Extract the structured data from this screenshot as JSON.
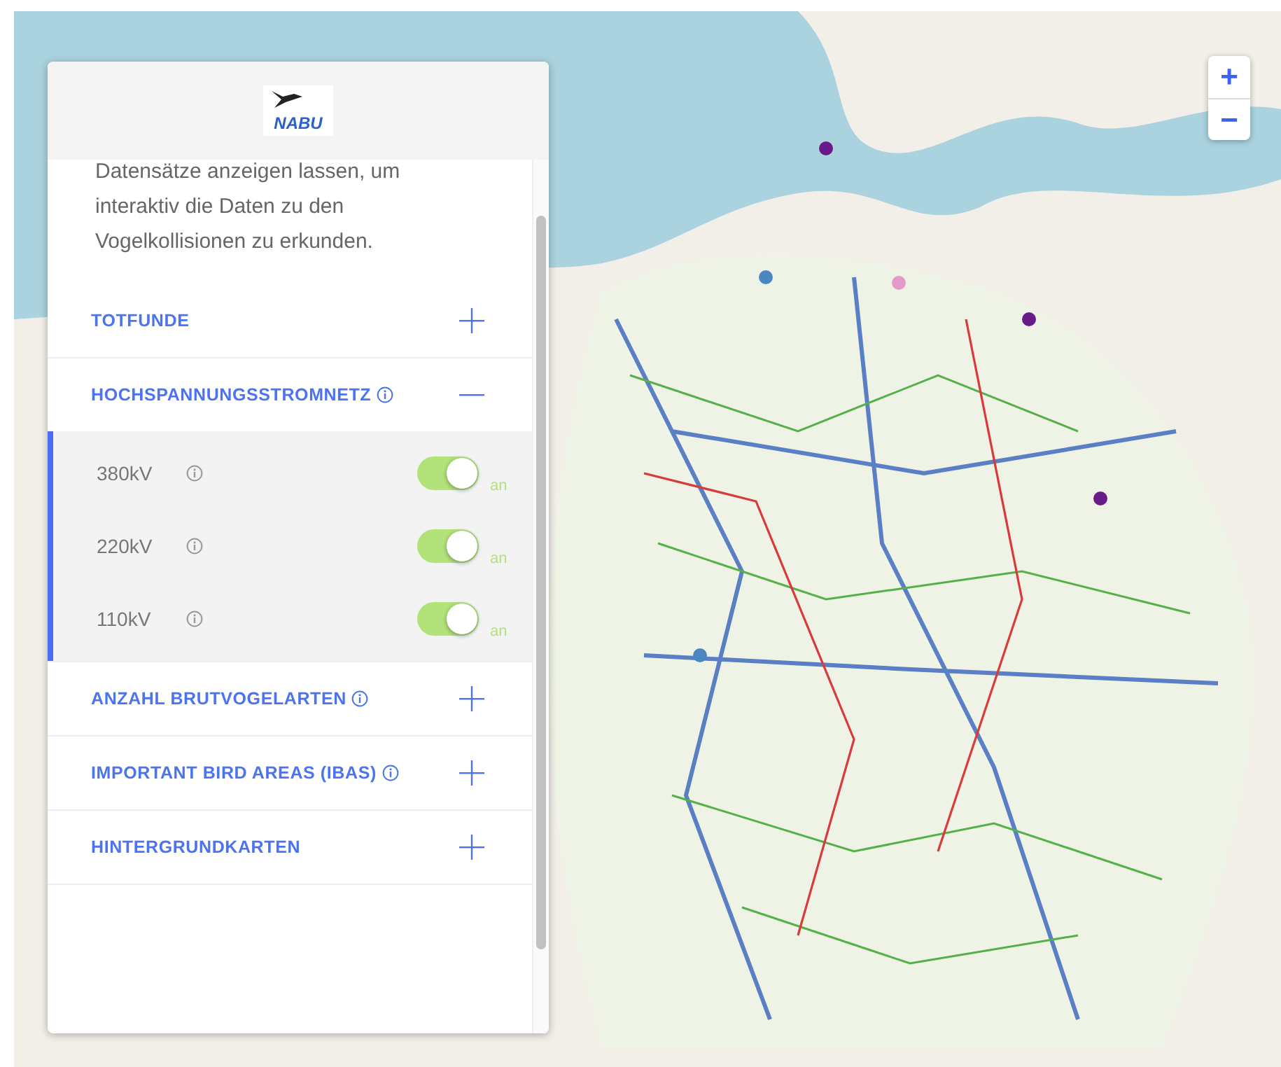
{
  "logo": {
    "text": "NABU"
  },
  "description": "Datensätze anzeigen lassen, um interaktiv die Daten zu den Vogelkollisionen zu erkunden.",
  "sections": [
    {
      "title": "TOTFUNDE",
      "info": false,
      "expanded": false
    },
    {
      "title": "HOCHSPANNUNGSSTROMNETZ",
      "info": true,
      "expanded": true,
      "layers": [
        {
          "label": "380kV",
          "on": true,
          "state_label": "an"
        },
        {
          "label": "220kV",
          "on": true,
          "state_label": "an"
        },
        {
          "label": "110kV",
          "on": true,
          "state_label": "an"
        }
      ]
    },
    {
      "title": "ANZAHL BRUTVOGELARTEN",
      "info": true,
      "expanded": false
    },
    {
      "title": "IMPORTANT BIRD AREAS (IBAS)",
      "info": true,
      "expanded": false
    },
    {
      "title": "HINTERGRUNDKARTEN",
      "info": false,
      "expanded": false
    }
  ],
  "zoom_controls": [
    "+",
    "−"
  ]
}
